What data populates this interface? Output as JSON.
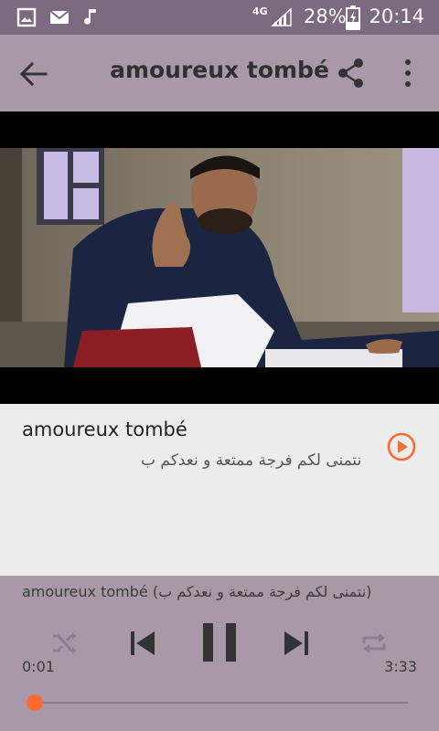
{
  "status_bar": {
    "network": "4G",
    "battery": "28%",
    "time": "20:14",
    "icons": [
      "image-icon",
      "mail-icon",
      "music-icon",
      "signal-icon",
      "battery-charging-icon"
    ]
  },
  "app_bar": {
    "title": "amoureux tombé",
    "icons": [
      "back-arrow-icon",
      "share-icon",
      "more-vert-icon"
    ]
  },
  "tracks": [
    {
      "title": "amoureux tombé",
      "subtitle": "نتمنى لكم فرجة ممتعة و نعدكم ب",
      "icon": "play-circle-icon"
    }
  ],
  "player": {
    "now_playing": "amoureux tombé (نتمنى لكم فرجة ممتعة و نعدكم ب)",
    "current_time": "0:01",
    "total_time": "3:33",
    "progress": 0.005,
    "controls": [
      "shuffle-icon",
      "previous-icon",
      "pause-icon",
      "next-icon",
      "repeat-icon"
    ]
  },
  "colors": {
    "status_bar": "#7c6a80",
    "primary": "#a898a8",
    "accent": "#ff6a33",
    "background": "#ececec"
  }
}
